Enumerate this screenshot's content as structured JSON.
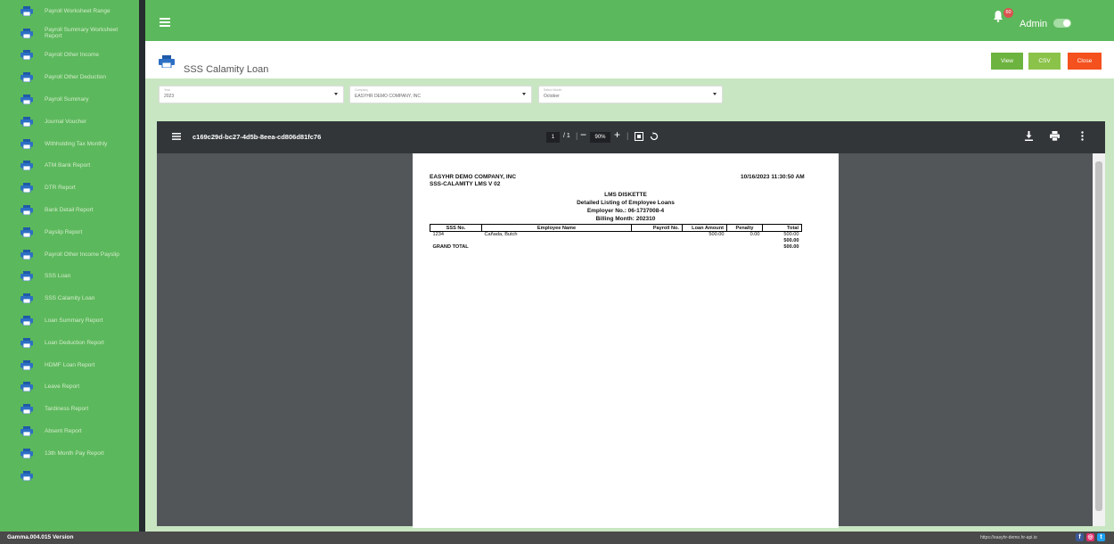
{
  "sidebar": {
    "items": [
      {
        "label": "Payroll Worksheet Range"
      },
      {
        "label": "Payroll Summary Worksheet Report"
      },
      {
        "label": "Payroll Other Income"
      },
      {
        "label": "Payroll Other Deduction"
      },
      {
        "label": "Payroll Summary"
      },
      {
        "label": "Journal Voucher"
      },
      {
        "label": "Withholding Tax Monthly"
      },
      {
        "label": "ATM Bank Report"
      },
      {
        "label": "DTR Report"
      },
      {
        "label": "Bank Detail Report"
      },
      {
        "label": "Payslip Report"
      },
      {
        "label": "Payroll Other Income Payslip"
      },
      {
        "label": "SSS Loan"
      },
      {
        "label": "SSS Calamity Loan"
      },
      {
        "label": "Loan Summary Report"
      },
      {
        "label": "Loan Deduction Report"
      },
      {
        "label": "HDMF Loan Report"
      },
      {
        "label": "Leave Report"
      },
      {
        "label": "Tardiness Report"
      },
      {
        "label": "Absent Report"
      },
      {
        "label": "13th Month Pay Report"
      },
      {
        "label": ""
      }
    ]
  },
  "header": {
    "notification_count": "60",
    "user": "Admin"
  },
  "page": {
    "title": "SSS Calamity Loan",
    "view_label": "View",
    "csv_label": "CSV",
    "close_label": "Close"
  },
  "filters": {
    "year_caption": "Year",
    "year_value": "2023",
    "company_caption": "Company",
    "company_value": "EASYHR DEMO COMPANY, INC",
    "month_caption": "Select Month",
    "month_value": "October"
  },
  "viewer": {
    "filename": "c169c29d-bc27-4d5b-8eea-cd806d81fc76",
    "page_current": "1",
    "page_total": "/ 1",
    "zoom": "90%"
  },
  "report": {
    "company": "EASYHR DEMO COMPANY, INC",
    "form": "SSS-CALAMITY LMS V 02",
    "timestamp": "10/16/2023 11:30:50 AM",
    "title": "LMS DISKETTE",
    "subtitle": "Detailed Listing of Employee Loans",
    "employer_no": "Employer No.: 06-1737008-4",
    "billing_month": "Billing Month: 202310",
    "columns": [
      "SSS No.",
      "Employee Name",
      "Payroll No.",
      "Loan Amount",
      "Penalty",
      "Total"
    ],
    "row": {
      "sss_no": "1234",
      "name": "Cañada, Butch",
      "payroll_no": "",
      "loan_amount": "500.00",
      "penalty": "0.00",
      "total": "500.00"
    },
    "subtotal": "500.00",
    "grand_total_label": "GRAND TOTAL",
    "grand_total": "500.00"
  },
  "footer": {
    "version": "Gamma.004.015 Version",
    "url": "https://easyhr-demo.hr-api.io"
  },
  "colors": {
    "brand_green": "#5cb85c",
    "view": "#6db33f",
    "csv": "#8bc34a",
    "close": "#f4511e"
  }
}
